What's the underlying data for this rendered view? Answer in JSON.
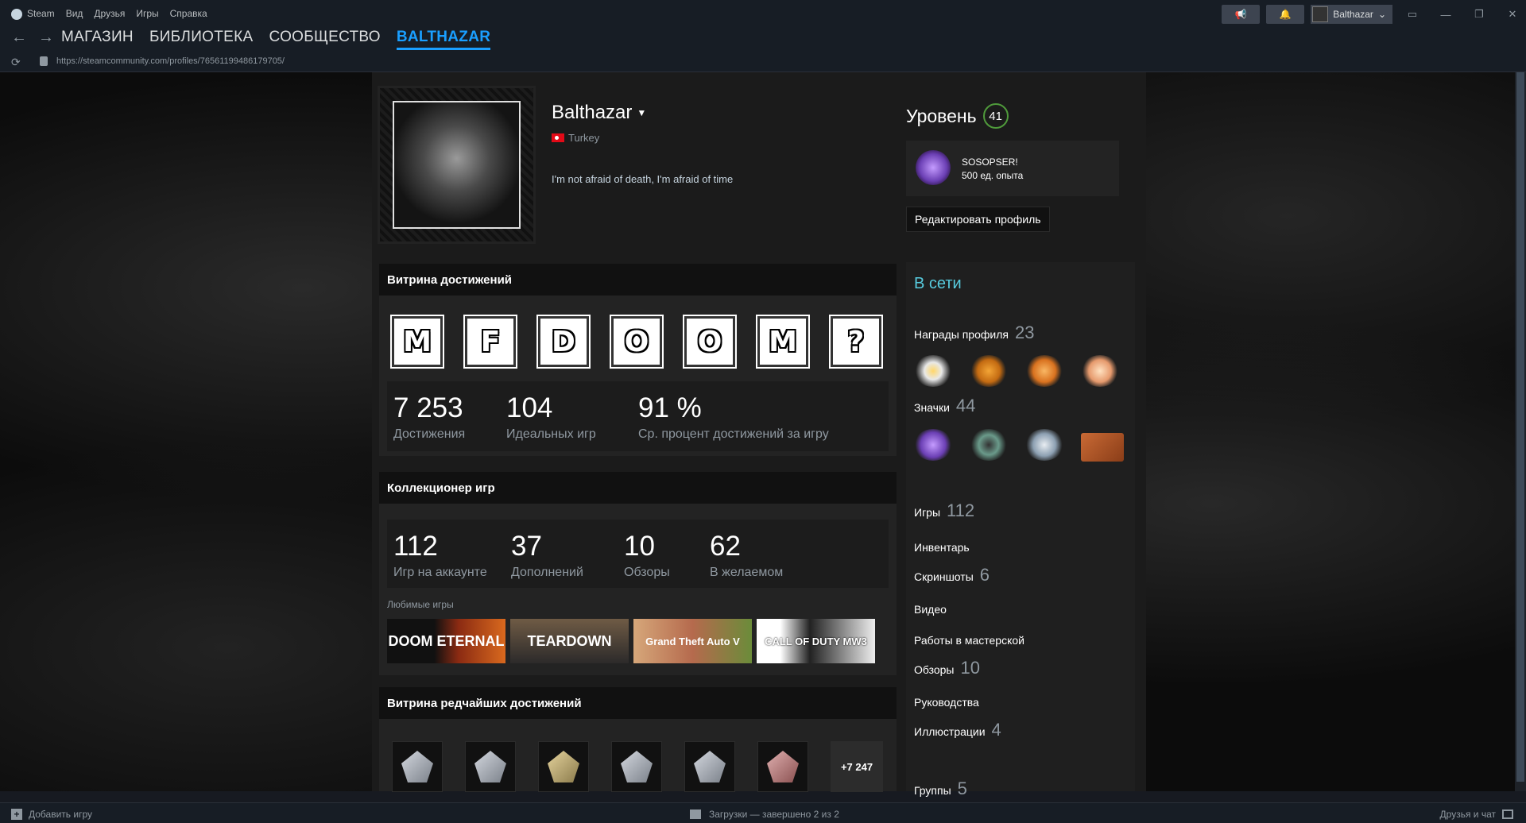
{
  "menubar": {
    "items": [
      "Steam",
      "Вид",
      "Друзья",
      "Игры",
      "Справка"
    ]
  },
  "user": {
    "name": "Balthazar"
  },
  "nav": {
    "links": [
      "МАГАЗИН",
      "БИБЛИОТЕКА",
      "СООБЩЕСТВО",
      "BALTHAZAR"
    ]
  },
  "url": "https://steamcommunity.com/profiles/76561199486179705/",
  "profile": {
    "name": "Balthazar",
    "country": "Turkey",
    "summary": "I'm not afraid of death, I'm afraid of time",
    "level_label": "Уровень",
    "level": "41",
    "level_badge_title": "SOSOPSER!",
    "level_badge_xp": "500 ед. опыта",
    "edit_button": "Редактировать профиль"
  },
  "achievement_showcase": {
    "title": "Витрина достижений",
    "tiles": [
      "M",
      "F",
      "D",
      "O",
      "O",
      "M",
      "?"
    ],
    "stats": [
      {
        "value": "7 253",
        "label": "Достижения"
      },
      {
        "value": "104",
        "label": "Идеальных игр"
      },
      {
        "value": "91 %",
        "label": "Ср. процент достижений за игру"
      }
    ]
  },
  "game_collector": {
    "title": "Коллекционер игр",
    "stats": [
      {
        "value": "112",
        "label": "Игр на аккаунте"
      },
      {
        "value": "37",
        "label": "Дополнений"
      },
      {
        "value": "10",
        "label": "Обзоры"
      },
      {
        "value": "62",
        "label": "В желаемом"
      }
    ],
    "favorites_label": "Любимые игры",
    "favorites": [
      "DOOM ETERNAL",
      "TEARDOWN",
      "Grand Theft Auto V",
      "CALL OF DUTY MW3"
    ]
  },
  "rare_achievements": {
    "title": "Витрина редчайших достижений",
    "more": "+7 247"
  },
  "sidebar": {
    "status": "В сети",
    "awards_label": "Награды профиля",
    "awards_count": "23",
    "badges_label": "Значки",
    "badges_count": "44",
    "games_label": "Игры",
    "games_count": "112",
    "inventory": "Инвентарь",
    "screenshots_label": "Скриншоты",
    "screenshots_count": "6",
    "videos": "Видео",
    "workshop": "Работы в мастерской",
    "reviews_label": "Обзоры",
    "reviews_count": "10",
    "guides": "Руководства",
    "artwork_label": "Иллюстрации",
    "artwork_count": "4",
    "groups_label": "Группы",
    "groups_count": "5"
  },
  "bottombar": {
    "add_game": "Добавить игру",
    "downloads": "Загрузки — завершено 2 из 2",
    "friends": "Друзья и чат"
  },
  "colors": {
    "accent": "#1a9fff",
    "online": "#57cbde",
    "level_ring": "#4f9a3b"
  }
}
